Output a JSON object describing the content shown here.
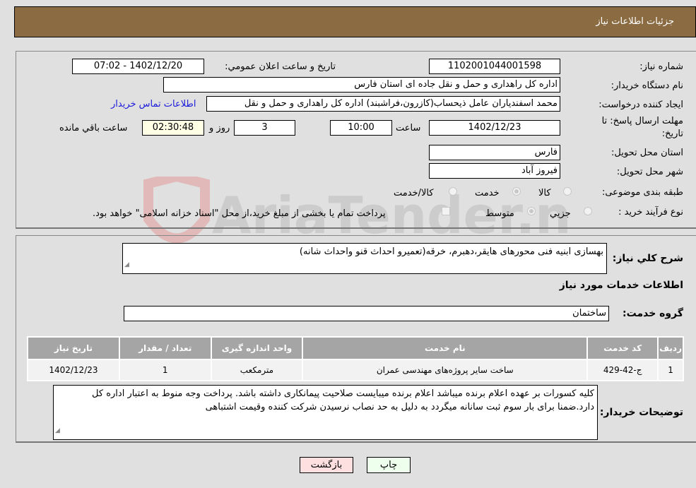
{
  "header": {
    "title": "جزئیات اطلاعات نیاز"
  },
  "fields": {
    "need_number": {
      "label": "شماره نیاز:",
      "value": "1102001044001598"
    },
    "announce_datetime": {
      "label": "تاريخ و ساعت اعلان عمومي:",
      "value": "1402/12/20 - 07:02"
    },
    "buyer_org": {
      "label": "نام دستگاه خریدار:",
      "value": "اداره کل راهداری و حمل و نقل جاده ای استان فارس"
    },
    "requester": {
      "label": "ایجاد کننده درخواست:",
      "value": "محمد اسفندیاران عامل ذیحساب(کازرون،فراشبند) اداره کل راهداری و حمل و نقل",
      "contact_link": "اطلاعات تماس خریدار"
    },
    "deadline": {
      "label": "مهلت ارسال پاسخ: تا تاریخ:",
      "date": "1402/12/23",
      "time_label": "ساعت",
      "time": "10:00",
      "days": "3",
      "days_label": "روز و",
      "remaining": "02:30:48",
      "remaining_label": "ساعت باقي مانده"
    },
    "province": {
      "label": "استان محل تحویل:",
      "value": "فارس"
    },
    "city": {
      "label": "شهر محل تحویل:",
      "value": "فیروز آباد"
    },
    "category": {
      "label": "طبقه بندی موضوعی:",
      "options": [
        {
          "label": "کالا",
          "checked": false
        },
        {
          "label": "خدمت",
          "checked": true
        },
        {
          "label": "کالا/خدمت",
          "checked": false
        }
      ]
    },
    "purchase_type": {
      "label": "نوع فرآیند خرید :",
      "options": [
        {
          "label": "جزيي",
          "checked": false
        },
        {
          "label": "متوسط",
          "checked": true
        }
      ],
      "treasury_note": "پرداخت تمام یا بخشی از مبلغ خرید،از محل \"اسناد خزانه اسلامی\" خواهد بود."
    }
  },
  "description": {
    "label": "شرح کلي نياز:",
    "value": "بهسازی ابنیه فنی محورهای هایقر،دهبرم، خرقه(تعمیرو احداث قنو واحداث شانه)"
  },
  "services_section": {
    "title": "اطلاعات خدمات مورد نیاز"
  },
  "service_group": {
    "label": "گروه خدمت:",
    "value": "ساختمان"
  },
  "table": {
    "headers": [
      "ردیف",
      "کد خدمت",
      "نام خدمت",
      "واحد اندازه گیری",
      "تعداد / مقدار",
      "تاریخ نیاز"
    ],
    "rows": [
      [
        "1",
        "ج-42-429",
        "ساخت سایر پروژه‌های مهندسی عمران",
        "مترمکعب",
        "1",
        "1402/12/23"
      ]
    ]
  },
  "buyer_notes": {
    "label": "توضیحات خریدار:",
    "value": "کلیه کسورات بر عهده اعلام برنده میباشد اعلام برنده میبایست صلاحیت پیمانکاری داشته باشد. پرداخت وجه منوط به اعتبار اداره کل دارد.ضمنا برای بار سوم ثبت سانانه میگردد به دلیل به حد نصاب نرسیدن شرکت کننده وقیمت اشتباهی"
  },
  "buttons": {
    "print": "چاپ",
    "back": "بازگشت"
  },
  "colors": {
    "header_bg": "#8b6c42",
    "print_bg": "#eeffee",
    "back_bg": "#ffe0e0",
    "link": "#1a1adb"
  }
}
